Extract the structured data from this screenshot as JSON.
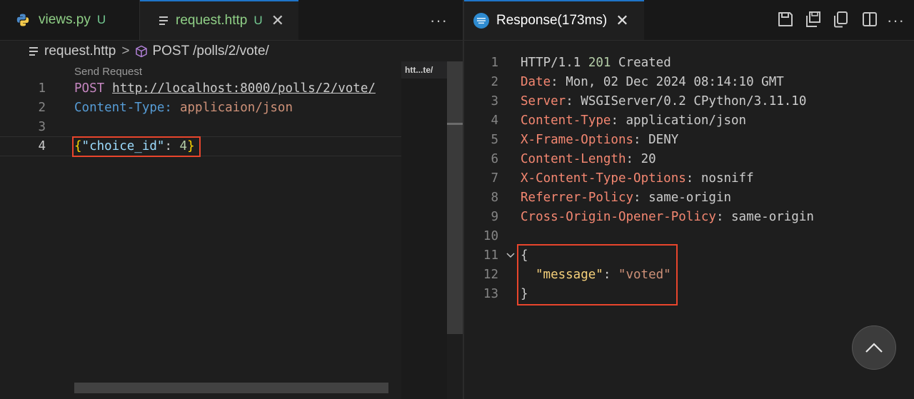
{
  "left_tabs": [
    {
      "label": "views.py",
      "badge": "U",
      "icon": "python-icon"
    },
    {
      "label": "request.http",
      "badge": "U",
      "icon": "file-lines-icon"
    }
  ],
  "left_more": "···",
  "breadcrumb": {
    "file": "request.http",
    "separator": ">",
    "symbol": "POST /polls/2/vote/"
  },
  "codelens": "Send Request",
  "minimap_label": "htt...te/",
  "request_lines": [
    {
      "num": "1",
      "method": "POST",
      "url": "http://localhost:8000/polls/2/vote/"
    },
    {
      "num": "2",
      "header_name": "Content-Type:",
      "header_value": "applicaion/json"
    },
    {
      "num": "3"
    },
    {
      "num": "4",
      "brace_open": "{",
      "key": "\"choice_id\"",
      "colon": ":",
      "value": "4",
      "brace_close": "}"
    }
  ],
  "right_tab": {
    "label": "Response(173ms)",
    "icon": "rest-client-icon"
  },
  "right_more": "···",
  "response_lines": [
    {
      "num": "1",
      "status_proto": "HTTP/1.1",
      "status_code": "201",
      "status_text": "Created"
    },
    {
      "num": "2",
      "name": "Date",
      "value": "Mon, 02 Dec 2024 08:14:10 GMT"
    },
    {
      "num": "3",
      "name": "Server",
      "value": "WSGIServer/0.2 CPython/3.11.10"
    },
    {
      "num": "4",
      "name": "Content-Type",
      "value": "application/json"
    },
    {
      "num": "5",
      "name": "X-Frame-Options",
      "value": "DENY"
    },
    {
      "num": "6",
      "name": "Content-Length",
      "value": "20"
    },
    {
      "num": "7",
      "name": "X-Content-Type-Options",
      "value": "nosniff"
    },
    {
      "num": "8",
      "name": "Referrer-Policy",
      "value": "same-origin"
    },
    {
      "num": "9",
      "name": "Cross-Origin-Opener-Policy",
      "value": "same-origin"
    },
    {
      "num": "10"
    },
    {
      "num": "11",
      "text": "{"
    },
    {
      "num": "12",
      "key": "\"message\"",
      "colon": ":",
      "value": "\"voted\""
    },
    {
      "num": "13",
      "text": "}"
    }
  ],
  "colors": {
    "accent": "#1e74c9",
    "highlight": "#e8452c"
  }
}
